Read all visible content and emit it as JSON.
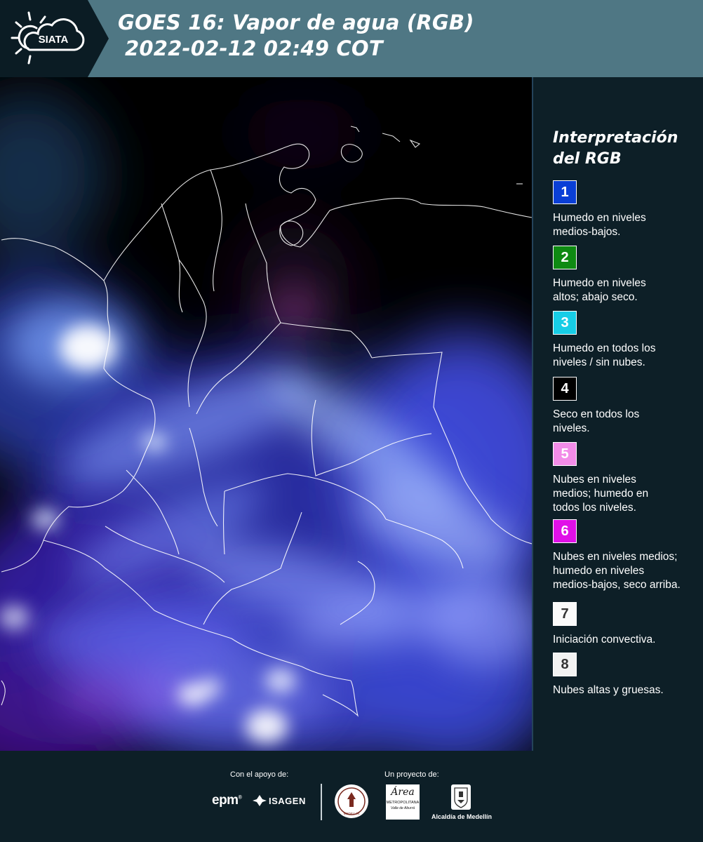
{
  "header": {
    "logo_text": "SIATA",
    "title_line1": "GOES 16: Vapor de agua (RGB)",
    "title_line2": "2022-02-12 02:49 COT"
  },
  "legend": {
    "title_line1": "Interpretación",
    "title_line2": "del RGB",
    "items": [
      {
        "num": "1",
        "color": "#0a3fd6",
        "num_color": "#ffffff",
        "lines": [
          "Humedo en niveles",
          "medios-bajos."
        ]
      },
      {
        "num": "2",
        "color": "#0e8a12",
        "num_color": "#ffffff",
        "lines": [
          "Humedo en niveles",
          "altos; abajo seco."
        ]
      },
      {
        "num": "3",
        "color": "#17cde6",
        "num_color": "#ffffff",
        "lines": [
          "Humedo en todos los",
          "niveles / sin nubes."
        ]
      },
      {
        "num": "4",
        "color": "#000000",
        "num_color": "#ffffff",
        "lines": [
          "Seco en todos los",
          "niveles."
        ]
      },
      {
        "num": "5",
        "color": "#f28ce8",
        "num_color": "#ffffff",
        "lines": [
          "Nubes en niveles",
          "medios; humedo en",
          "todos los niveles."
        ]
      },
      {
        "num": "6",
        "color": "#e010e8",
        "num_color": "#ffffff",
        "lines": [
          "Nubes en niveles medios;",
          "humedo en niveles",
          "medios-bajos, seco arriba."
        ]
      },
      {
        "num": "7",
        "color": "#fafafa",
        "num_color": "#333333",
        "lines": [
          "Iniciación convectiva."
        ]
      },
      {
        "num": "8",
        "color": "#f2f2f2",
        "num_color": "#333333",
        "lines": [
          "Nubes altas y gruesas."
        ]
      }
    ]
  },
  "footer": {
    "support_label": "Con el apoyo de:",
    "project_label": "Un proyecto de:",
    "logos": {
      "epm": "epm",
      "isagen": "ISAGEN",
      "area_word": "Área",
      "area_sub1": "METROPOLITANA",
      "area_sub2": "Valle de Aburrá",
      "alcaldia": "Alcaldía de Medellín",
      "medellin_seal": "MEDELLÍN"
    }
  }
}
